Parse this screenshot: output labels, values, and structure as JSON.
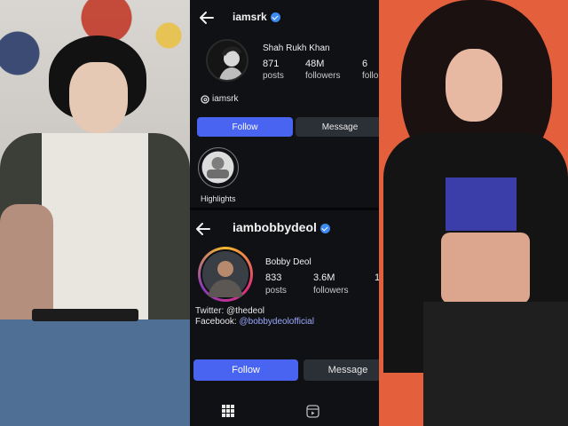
{
  "profile1": {
    "username": "iamsrk",
    "display_name": "Shah Rukh Khan",
    "stats": [
      {
        "value": "871",
        "label": "posts"
      },
      {
        "value": "48M",
        "label": "followers"
      },
      {
        "value": "6",
        "label": "follo"
      }
    ],
    "threads_handle": "iamsrk",
    "follow_label": "Follow",
    "message_label": "Message",
    "highlight_label": "Highlights"
  },
  "profile2": {
    "username": "iambobbydeol",
    "display_name": "Bobby Deol",
    "stats": [
      {
        "value": "833",
        "label": "posts"
      },
      {
        "value": "3.6M",
        "label": "followers"
      },
      {
        "value": "1",
        "label": ""
      }
    ],
    "bio_line1_prefix": "Twitter: ",
    "bio_line1_value": "@thedeol",
    "bio_line2_prefix": "Facebook: ",
    "bio_line2_value": "@bobbydeolofficial",
    "follow_label": "Follow",
    "message_label": "Message"
  },
  "icons": {
    "back": "arrow-left-icon",
    "verified": "verified-badge-icon",
    "threads": "threads-icon",
    "grid": "grid-icon",
    "reels": "reels-icon"
  },
  "colors": {
    "follow_button": "#4a64f2",
    "verified": "#3d8bf2",
    "story_ring": "#e2307a"
  }
}
